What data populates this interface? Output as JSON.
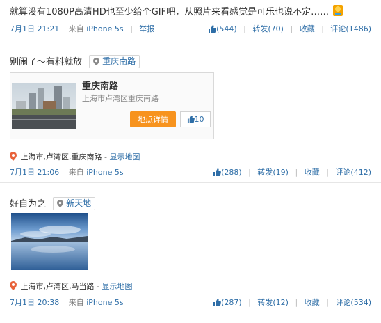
{
  "posts": [
    {
      "text": "就算没有1080P高清HD也至少给个GIF吧，从照片来看感觉是可乐也说不定……",
      "emoji_icon": "thinking-emoji-icon",
      "date": "7月1日 21:21",
      "source_prefix": "来自",
      "source_device": "iPhone 5s",
      "report_label": "举报",
      "likes": "(544)",
      "reposts": "转发(70)",
      "favorite": "收藏",
      "comments": "评论(1486)"
    },
    {
      "text": "别闹了～有料就放",
      "location_tag": "重庆南路",
      "place": {
        "name": "重庆南路",
        "address": "上海市卢湾区重庆南路",
        "details_label": "地点详情",
        "likes": "10"
      },
      "geo_text": "上海市,卢湾区,重庆南路",
      "show_map_label": "显示地图",
      "date": "7月1日 21:06",
      "source_prefix": "来自",
      "source_device": "iPhone 5s",
      "likes": "(288)",
      "reposts": "转发(19)",
      "favorite": "收藏",
      "comments": "评论(412)"
    },
    {
      "text": "好自为之",
      "location_tag": "新天地",
      "geo_text": "上海市,卢湾区,马当路",
      "show_map_label": "显示地图",
      "date": "7月1日 20:38",
      "source_prefix": "来自",
      "source_device": "iPhone 5s",
      "likes": "(287)",
      "reposts": "转发(12)",
      "favorite": "收藏",
      "comments": "评论(534)"
    }
  ],
  "colors": {
    "link": "#2e6ea7",
    "button_orange": "#f7931e",
    "geo_pin": "#e8623a"
  },
  "separator": "|",
  "map_link_prefix": " - "
}
